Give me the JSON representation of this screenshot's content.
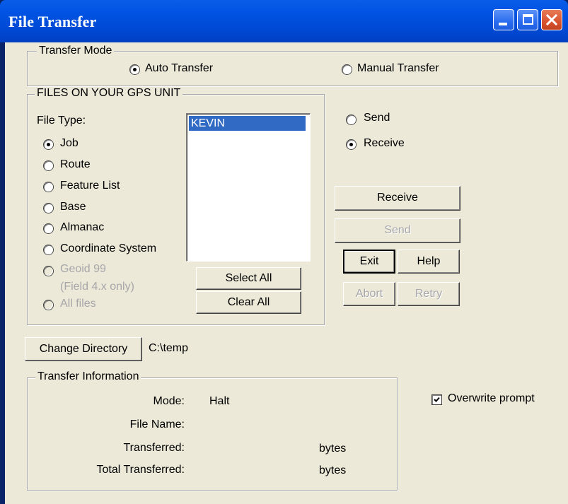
{
  "window": {
    "title": "File Transfer"
  },
  "transfer_mode": {
    "legend": "Transfer Mode",
    "options": [
      {
        "label": "Auto Transfer",
        "selected": true
      },
      {
        "label": "Manual Transfer",
        "selected": false
      }
    ]
  },
  "gps_files": {
    "legend": "FILES ON YOUR GPS UNIT",
    "file_type_label": "File Type:",
    "file_types": [
      {
        "label": "Job",
        "selected": true,
        "enabled": true
      },
      {
        "label": "Route",
        "selected": false,
        "enabled": true
      },
      {
        "label": "Feature List",
        "selected": false,
        "enabled": true
      },
      {
        "label": "Base",
        "selected": false,
        "enabled": true
      },
      {
        "label": "Almanac",
        "selected": false,
        "enabled": true
      },
      {
        "label": "Coordinate System",
        "selected": false,
        "enabled": true
      },
      {
        "label": "Geoid 99",
        "sublabel": "(Field 4.x only)",
        "selected": false,
        "enabled": false
      },
      {
        "label": "All files",
        "selected": false,
        "enabled": false
      }
    ],
    "list_items": [
      {
        "label": "KEVIN",
        "selected": true
      }
    ],
    "select_all_label": "Select All",
    "clear_all_label": "Clear All"
  },
  "direction": {
    "options": [
      {
        "label": "Send",
        "selected": false
      },
      {
        "label": "Receive",
        "selected": true
      }
    ]
  },
  "actions": {
    "receive_label": "Receive",
    "send_label": "Send",
    "exit_label": "Exit",
    "help_label": "Help",
    "abort_label": "Abort",
    "retry_label": "Retry"
  },
  "directory": {
    "button_label": "Change Directory",
    "path": "C:\\temp"
  },
  "transfer_info": {
    "legend": "Transfer Information",
    "mode_label": "Mode:",
    "mode_value": "Halt",
    "file_name_label": "File Name:",
    "transferred_label": "Transferred:",
    "transferred_unit": "bytes",
    "total_label": "Total Transferred:",
    "total_unit": "bytes"
  },
  "overwrite_prompt": {
    "label": "Overwrite prompt",
    "checked": true
  }
}
